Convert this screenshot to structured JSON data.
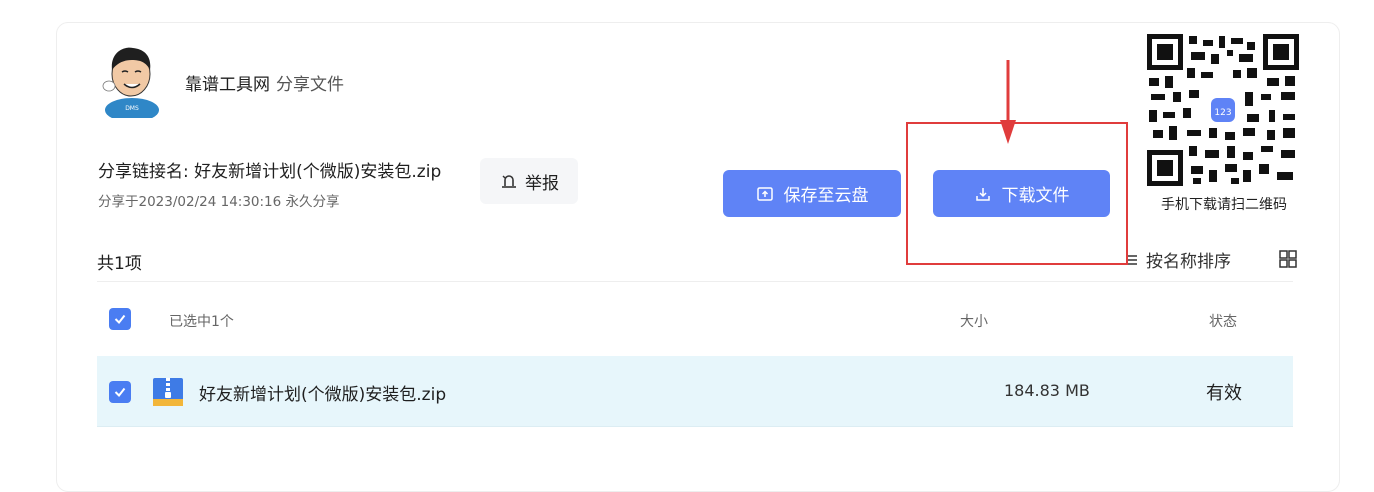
{
  "sharer": {
    "name": "靠谱工具网",
    "suffix": "分享文件"
  },
  "share": {
    "title": "分享链接名: 好友新增计划(个微版)安装包.zip",
    "meta": "分享于2023/02/24 14:30:16 永久分享"
  },
  "buttons": {
    "report_label": "举报",
    "save_label": "保存至云盘",
    "download_label": "下载文件"
  },
  "qr": {
    "caption": "手机下载请扫二维码",
    "badge_text": "123"
  },
  "list": {
    "count_label": "共1项",
    "sort_label": "按名称排序",
    "header": {
      "selected": "已选中1个",
      "size": "大小",
      "status": "状态"
    },
    "files": [
      {
        "name": "好友新增计划(个微版)安装包.zip",
        "size": "184.83 MB",
        "status": "有效",
        "checked": true
      }
    ]
  },
  "colors": {
    "primary": "#5f83f6",
    "checkbox": "#4a7df2",
    "selected_row": "#e7f6fb",
    "annotation": "#e03c3c"
  },
  "avatar": {
    "shirt_text": "DMS"
  }
}
